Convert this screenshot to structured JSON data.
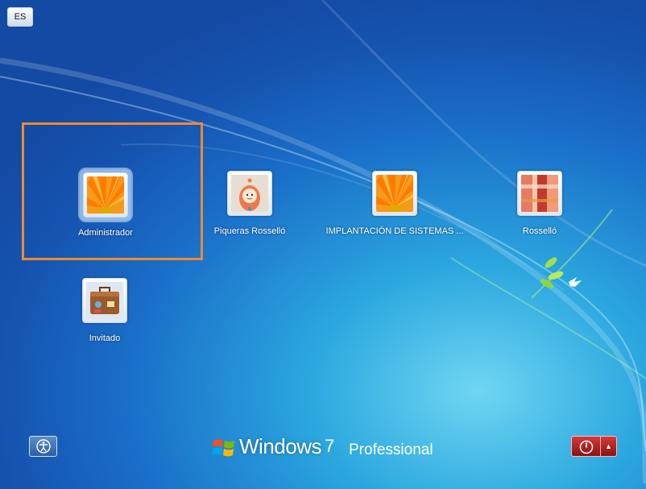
{
  "language_button": {
    "label": "ES"
  },
  "users": [
    {
      "name": "Administrador",
      "picture": "orange-flower-picture",
      "selected": true
    },
    {
      "name": "Piqueras Rosselló",
      "picture": "toy-figure-picture",
      "selected": false
    },
    {
      "name": "IMPLANTACIÓN DE SISTEMAS ...",
      "picture": "orange-flower-picture",
      "selected": false
    },
    {
      "name": "Rosselló",
      "picture": "fabric-pattern-picture",
      "selected": false
    },
    {
      "name": "Invitado",
      "picture": "suitcase-picture",
      "selected": false
    }
  ],
  "branding": {
    "brand": "Windows",
    "version": "7",
    "edition": "Professional"
  },
  "icons": {
    "accessibility": "ease-of-access-icon",
    "power": "power-icon",
    "power_menu": "triangle-up-icon",
    "logo": "windows-flag-icon"
  },
  "colors": {
    "highlight": "#f08a30",
    "power_button": "#b22222",
    "background": "#1a6fc9"
  }
}
